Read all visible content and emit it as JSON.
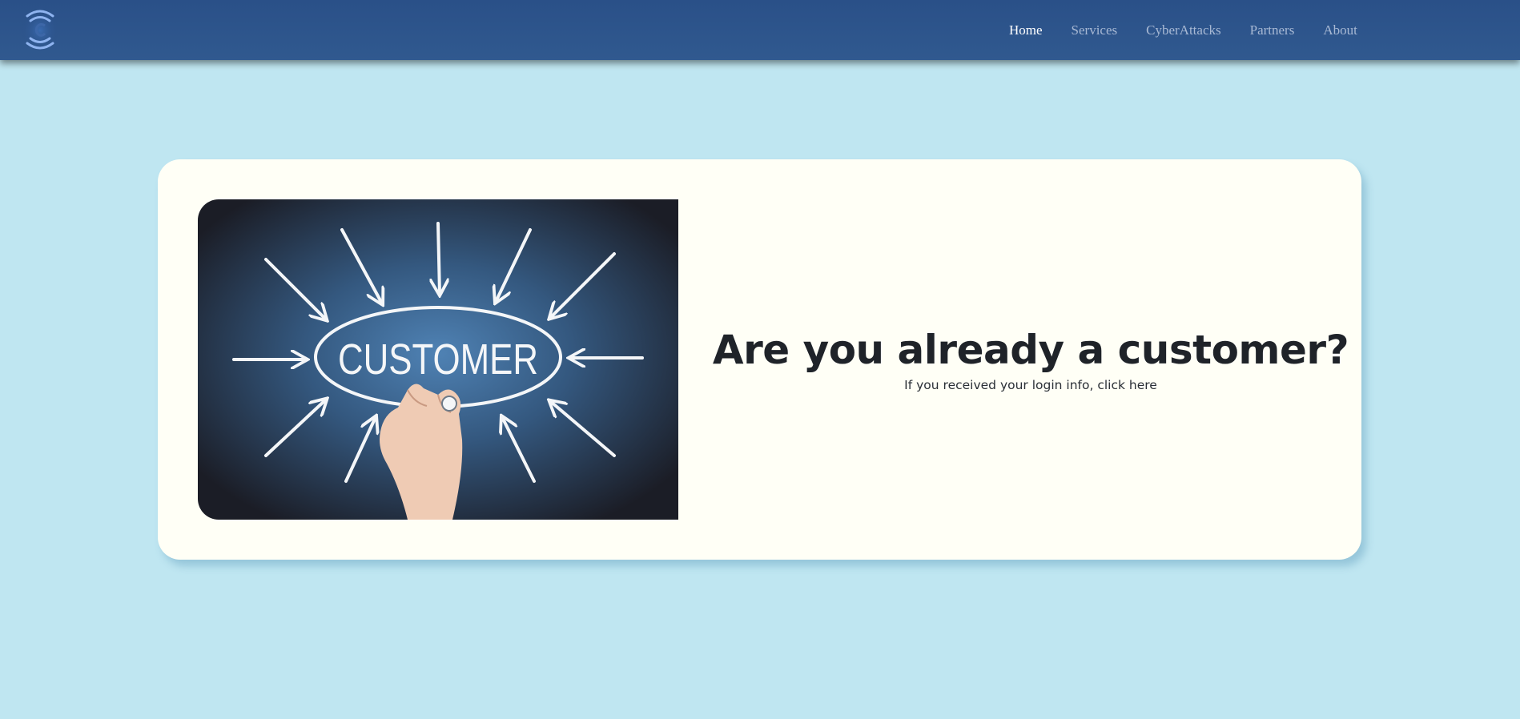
{
  "nav": {
    "logo_icon": "signal-c-logo-icon",
    "items": [
      {
        "label": "Home",
        "active": true
      },
      {
        "label": "Services",
        "active": false
      },
      {
        "label": "CyberAttacks",
        "active": false
      },
      {
        "label": "Partners",
        "active": false
      },
      {
        "label": "About",
        "active": false
      }
    ]
  },
  "hero": {
    "image_text": "CUSTOMER",
    "title": "Are you already a customer?",
    "subtitle": "If you received your login info, click here"
  },
  "colors": {
    "page_background": "#bfe6f1",
    "navbar": "#2d548b",
    "nav_active": "#ffffff",
    "nav_inactive": "#a8b9d4",
    "card_background": "#fffff6",
    "title_text": "#1f2329"
  }
}
